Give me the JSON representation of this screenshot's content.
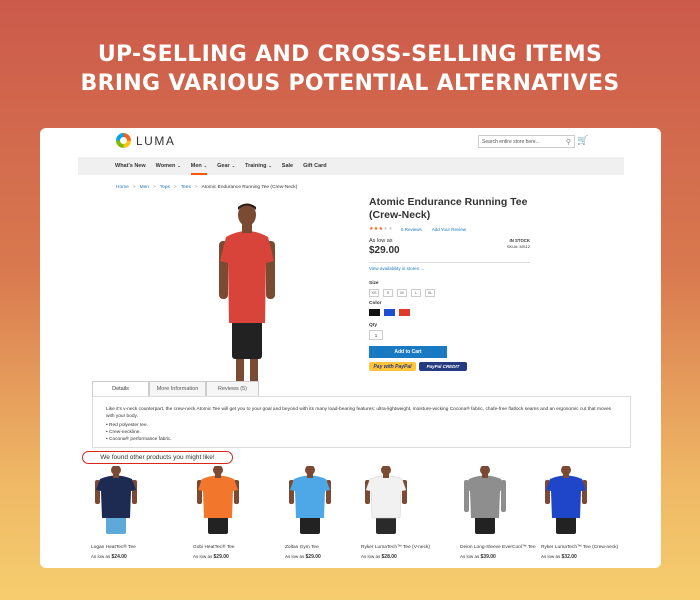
{
  "headline": {
    "line1": "UP-SELLING AND CROSS-SELLING ITEMS",
    "line2": "BRING VARIOUS POTENTIAL ALTERNATIVES"
  },
  "store": {
    "logo_text": "LUMA",
    "search_placeholder": "Search entire store here...",
    "nav": [
      {
        "label": "What's New",
        "chevron": false
      },
      {
        "label": "Women",
        "chevron": true
      },
      {
        "label": "Men",
        "chevron": true,
        "active": true
      },
      {
        "label": "Gear",
        "chevron": true
      },
      {
        "label": "Training",
        "chevron": true
      },
      {
        "label": "Sale",
        "chevron": false
      },
      {
        "label": "Gift Card",
        "chevron": false
      }
    ],
    "breadcrumb": [
      "Home",
      "Men",
      "Tops",
      "Tees",
      "Atomic Endurance Running Tee (Crew-Neck)"
    ],
    "chevron_glyph": "⌄"
  },
  "product": {
    "title": "Atomic Endurance Running Tee (Crew-Neck)",
    "rating_percent": 60,
    "reviews_link": "5 Reviews",
    "add_review": "Add Your Review",
    "as_low_as": "As low as",
    "price": "$29.00",
    "stock": "IN STOCK",
    "sku": "SKU#: MS12",
    "availability_link": "View availability in stores ...",
    "size_label": "Size",
    "sizes": [
      "XS",
      "S",
      "M",
      "L",
      "XL"
    ],
    "color_label": "Color",
    "colors": [
      "#111111",
      "#1e4fd1",
      "#e03a2a"
    ],
    "qty_label": "Qty",
    "qty_value": "1",
    "add_to_cart": "Add to Cart",
    "paypal_checkout": "Pay with PayPal",
    "paypal_credit": "PayPal CREDIT",
    "shirt_color": "#d9443a"
  },
  "tabs": [
    {
      "label": "Details",
      "active": true
    },
    {
      "label": "More Information",
      "active": false
    },
    {
      "label": "Reviews (5)",
      "active": false
    }
  ],
  "details": {
    "description": "Like it's v-neck counterpart, the crew-neck Atomic Tee will get you to your goal and beyond with its many load-bearing features: ultra-lightweight, moisture-wicking Cocona® fabric, chafe-free flatlock seams and an ergonomic cut that moves with your body.",
    "bullets": [
      "Red polyester tee.",
      "Crew-neckline.",
      "Cocona® performance fabric."
    ]
  },
  "callout": "We found other products you might like!",
  "related": [
    {
      "name": "Logan HeatTec® Tee",
      "as_low": "As low as",
      "price": "$24.00",
      "shirt": "#1d2a52",
      "shorts": "#5ea9d8"
    },
    {
      "name": "Gobi HeatTec® Tee",
      "as_low": "As low as",
      "price": "$29.00",
      "shirt": "#f2762c",
      "shorts": "#222222"
    },
    {
      "name": "Zoltan Gym Tee",
      "as_low": "As low as",
      "price": "$29.00",
      "shirt": "#4ea7e6",
      "shorts": "#222222"
    },
    {
      "name": "Ryker LumaTech™ Tee (V-neck)",
      "as_low": "As low as",
      "price": "$28.00",
      "shirt": "#f1f1f1",
      "shorts": "#2a2a2a"
    },
    {
      "name": "Deion Long-Sleeve EverCool™ Tee",
      "as_low": "As low as",
      "price": "$39.00",
      "shirt": "#8e8e8e",
      "shorts": "#222222"
    },
    {
      "name": "Ryker LumaTech™ Tee (Crew-neck)",
      "as_low": "As low as",
      "price": "$32.00",
      "shirt": "#1f45c9",
      "shorts": "#222222"
    }
  ]
}
